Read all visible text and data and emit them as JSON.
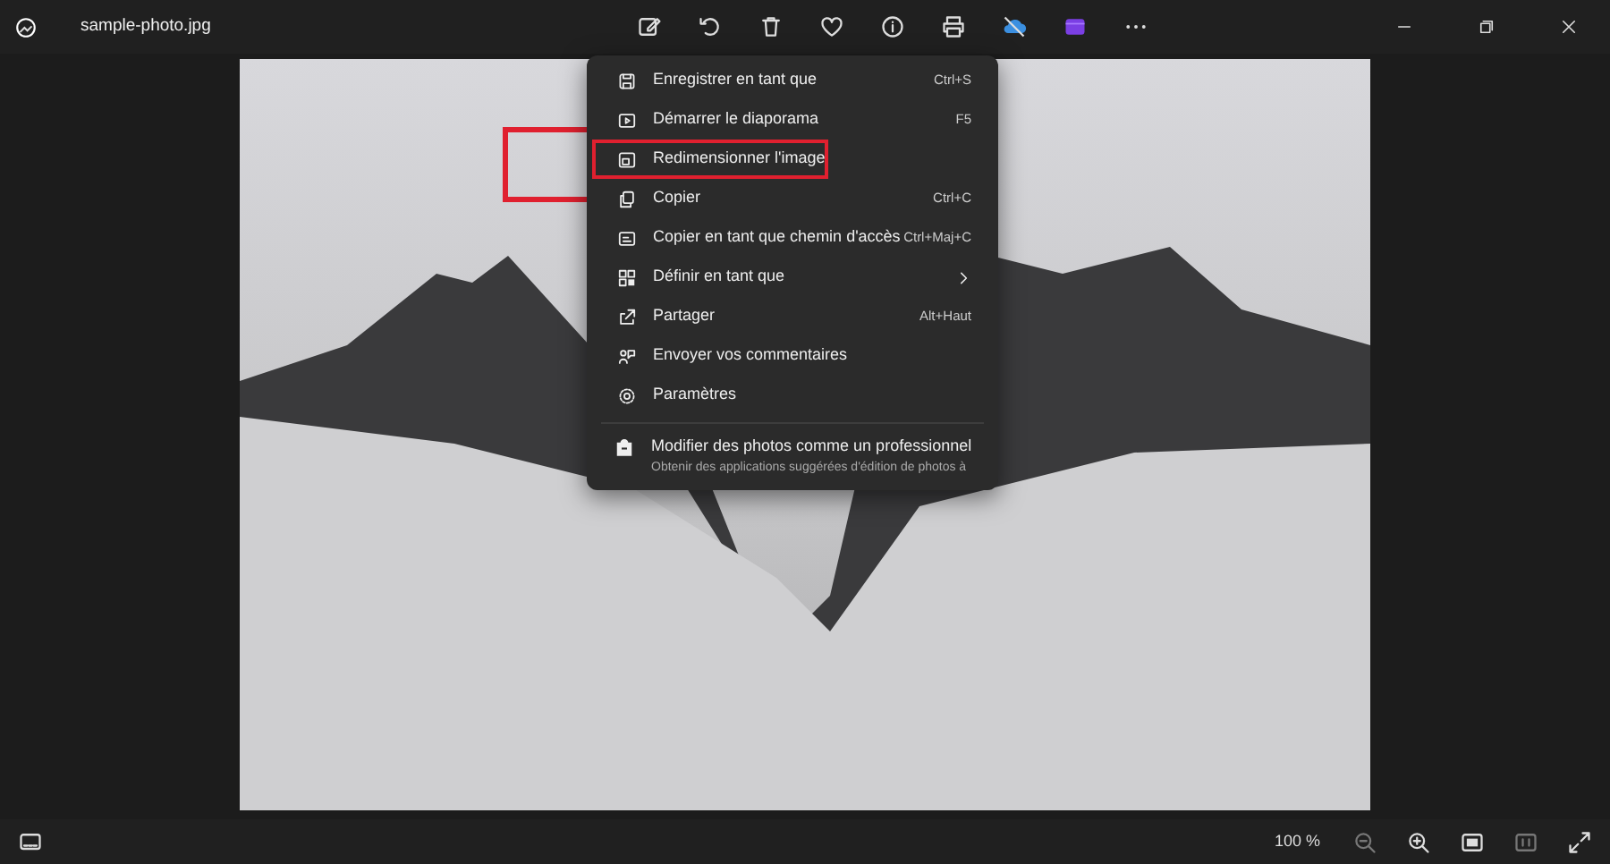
{
  "window": {
    "title": "sample-photo.jpg"
  },
  "menu": {
    "items": [
      {
        "kind": "item",
        "label": "Enregistrer en tant que",
        "shortcut": "Ctrl+S",
        "submenu": false,
        "highlighted": false
      },
      {
        "kind": "item",
        "label": "Démarrer le diaporama",
        "shortcut": "F5",
        "submenu": false,
        "highlighted": false
      },
      {
        "kind": "item",
        "label": "Redimensionner l'image",
        "submenu": false,
        "highlighted": true
      },
      {
        "kind": "item",
        "label": "Copier",
        "shortcut": "Ctrl+C",
        "submenu": false,
        "highlighted": false
      },
      {
        "kind": "item",
        "label": "Copier en tant que chemin d'accès",
        "shortcut": "Ctrl+Maj+C",
        "submenu": false,
        "highlighted": false
      },
      {
        "kind": "item",
        "label": "Définir en tant que",
        "submenu": true,
        "highlighted": false
      },
      {
        "kind": "item",
        "label": "Partager",
        "shortcut": "Alt+Haut",
        "submenu": false,
        "highlighted": false
      },
      {
        "kind": "item",
        "label": "Envoyer vos commentaires",
        "submenu": false,
        "highlighted": false
      },
      {
        "kind": "item",
        "label": "Paramètres",
        "submenu": false,
        "highlighted": false
      },
      {
        "kind": "promo",
        "label": "Modifier des photos comme un professionnel",
        "subtitle": "Obtenir des applications suggérées d'édition de photos à"
      }
    ]
  },
  "status_bar": {
    "zoom": "100 %"
  }
}
